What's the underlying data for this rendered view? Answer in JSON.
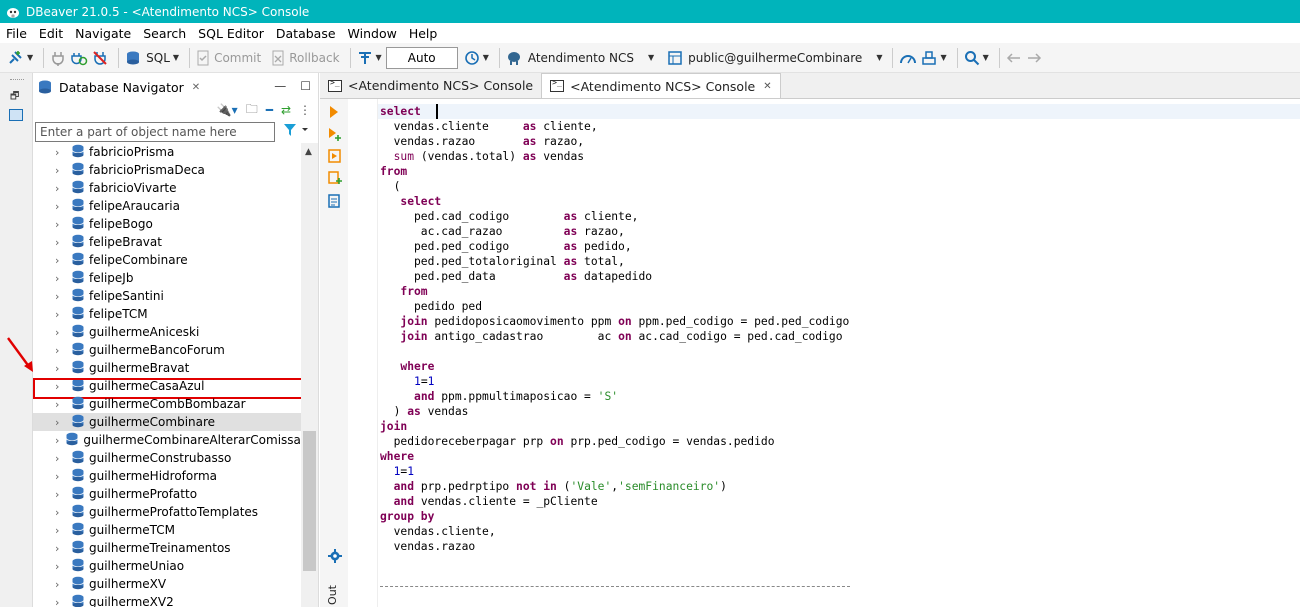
{
  "window": {
    "title": "DBeaver 21.0.5 - <Atendimento NCS> Console"
  },
  "menu": [
    "File",
    "Edit",
    "Navigate",
    "Search",
    "SQL Editor",
    "Database",
    "Window",
    "Help"
  ],
  "toolbar": {
    "sql_label": "SQL",
    "commit_label": "Commit",
    "rollback_label": "Rollback",
    "transaction_mode": "Auto",
    "connection_label": "Atendimento NCS",
    "schema_label": "public@guilhermeCombinare"
  },
  "navigator": {
    "title": "Database Navigator",
    "filter_placeholder": "Enter a part of object name here",
    "items": [
      {
        "name": "fabricioPrisma",
        "state": ""
      },
      {
        "name": "fabricioPrismaDeca",
        "state": ""
      },
      {
        "name": "fabricioVivarte",
        "state": ""
      },
      {
        "name": "felipeAraucaria",
        "state": ""
      },
      {
        "name": "felipeBogo",
        "state": ""
      },
      {
        "name": "felipeBravat",
        "state": ""
      },
      {
        "name": "felipeCombinare",
        "state": ""
      },
      {
        "name": "felipeJb",
        "state": ""
      },
      {
        "name": "felipeSantini",
        "state": ""
      },
      {
        "name": "felipeTCM",
        "state": ""
      },
      {
        "name": "guilhermeAniceski",
        "state": ""
      },
      {
        "name": "guilhermeBancoForum",
        "state": ""
      },
      {
        "name": "guilhermeBravat",
        "state": ""
      },
      {
        "name": "guilhermeCasaAzul",
        "state": "highlighted"
      },
      {
        "name": "guilhermeCombBombazar",
        "state": ""
      },
      {
        "name": "guilhermeCombinare",
        "state": "selected"
      },
      {
        "name": "guilhermeCombinareAlterarComissao",
        "state": ""
      },
      {
        "name": "guilhermeConstrubasso",
        "state": ""
      },
      {
        "name": "guilhermeHidroforma",
        "state": ""
      },
      {
        "name": "guilhermeProfatto",
        "state": ""
      },
      {
        "name": "guilhermeProfattoTemplates",
        "state": ""
      },
      {
        "name": "guilhermeTCM",
        "state": ""
      },
      {
        "name": "guilhermeTreinamentos",
        "state": ""
      },
      {
        "name": "guilhermeUniao",
        "state": ""
      },
      {
        "name": "guilhermeXV",
        "state": ""
      },
      {
        "name": "guilhermeXV2",
        "state": ""
      }
    ]
  },
  "editor": {
    "tabs": [
      {
        "label": "<Atendimento NCS> Console",
        "active": false
      },
      {
        "label": "<Atendimento NCS> Console",
        "active": true
      }
    ],
    "output_label": "Out",
    "code_lines": [
      [
        [
          "kw",
          "select"
        ],
        [
          "",
          "  "
        ]
      ],
      [
        [
          "",
          "  vendas.cliente     "
        ],
        [
          "kw",
          "as"
        ],
        [
          "",
          " cliente,"
        ]
      ],
      [
        [
          "",
          "  vendas.razao       "
        ],
        [
          "kw",
          "as"
        ],
        [
          "",
          " razao,"
        ]
      ],
      [
        [
          "",
          "  "
        ],
        [
          "fn",
          "sum"
        ],
        [
          "",
          " (vendas.total) "
        ],
        [
          "kw",
          "as"
        ],
        [
          "",
          " vendas"
        ]
      ],
      [
        [
          "kw",
          "from"
        ]
      ],
      [
        [
          "",
          "  ("
        ]
      ],
      [
        [
          "",
          "   "
        ],
        [
          "kw",
          "select"
        ]
      ],
      [
        [
          "",
          "     ped.cad_codigo        "
        ],
        [
          "kw",
          "as"
        ],
        [
          "",
          " cliente,"
        ]
      ],
      [
        [
          "",
          "      ac.cad_razao         "
        ],
        [
          "kw",
          "as"
        ],
        [
          "",
          " razao,"
        ]
      ],
      [
        [
          "",
          "     ped.ped_codigo        "
        ],
        [
          "kw",
          "as"
        ],
        [
          "",
          " pedido,"
        ]
      ],
      [
        [
          "",
          "     ped.ped_totaloriginal "
        ],
        [
          "kw",
          "as"
        ],
        [
          "",
          " total,"
        ]
      ],
      [
        [
          "",
          "     ped.ped_data          "
        ],
        [
          "kw",
          "as"
        ],
        [
          "",
          " datapedido"
        ]
      ],
      [
        [
          "",
          "   "
        ],
        [
          "kw",
          "from"
        ]
      ],
      [
        [
          "",
          "     pedido ped"
        ]
      ],
      [
        [
          "",
          "   "
        ],
        [
          "kw",
          "join"
        ],
        [
          "",
          " pedidoposicaomovimento ppm "
        ],
        [
          "kw",
          "on"
        ],
        [
          "",
          " ppm.ped_codigo = ped.ped_codigo"
        ]
      ],
      [
        [
          "",
          "   "
        ],
        [
          "kw",
          "join"
        ],
        [
          "",
          " antigo_cadastrao        ac "
        ],
        [
          "kw",
          "on"
        ],
        [
          "",
          " ac.cad_codigo = ped.cad_codigo"
        ]
      ],
      [
        [
          "",
          ""
        ]
      ],
      [
        [
          "",
          "   "
        ],
        [
          "kw",
          "where"
        ]
      ],
      [
        [
          "",
          "     "
        ],
        [
          "num",
          "1"
        ],
        [
          "",
          "="
        ],
        [
          "num",
          "1"
        ]
      ],
      [
        [
          "",
          "     "
        ],
        [
          "kw",
          "and"
        ],
        [
          "",
          " ppm.ppmultimaposicao = "
        ],
        [
          "str",
          "'S'"
        ]
      ],
      [
        [
          "",
          "  ) "
        ],
        [
          "kw",
          "as"
        ],
        [
          "",
          " vendas"
        ]
      ],
      [
        [
          "kw",
          "join"
        ]
      ],
      [
        [
          "",
          "  pedidoreceberpagar prp "
        ],
        [
          "kw",
          "on"
        ],
        [
          "",
          " prp.ped_codigo = vendas.pedido"
        ]
      ],
      [
        [
          "kw",
          "where"
        ]
      ],
      [
        [
          "",
          "  "
        ],
        [
          "num",
          "1"
        ],
        [
          "",
          "="
        ],
        [
          "num",
          "1"
        ]
      ],
      [
        [
          "",
          "  "
        ],
        [
          "kw",
          "and"
        ],
        [
          "",
          " prp.pedrptipo "
        ],
        [
          "kw",
          "not in"
        ],
        [
          "",
          " ("
        ],
        [
          "str",
          "'Vale'"
        ],
        [
          "",
          ","
        ],
        [
          "str",
          "'semFinanceiro'"
        ],
        [
          "",
          ")"
        ]
      ],
      [
        [
          "",
          "  "
        ],
        [
          "kw",
          "and"
        ],
        [
          "",
          " vendas.cliente = _pCliente"
        ]
      ],
      [
        [
          "kw",
          "group by"
        ]
      ],
      [
        [
          "",
          "  vendas.cliente,"
        ]
      ],
      [
        [
          "",
          "  vendas.razao"
        ]
      ]
    ]
  }
}
